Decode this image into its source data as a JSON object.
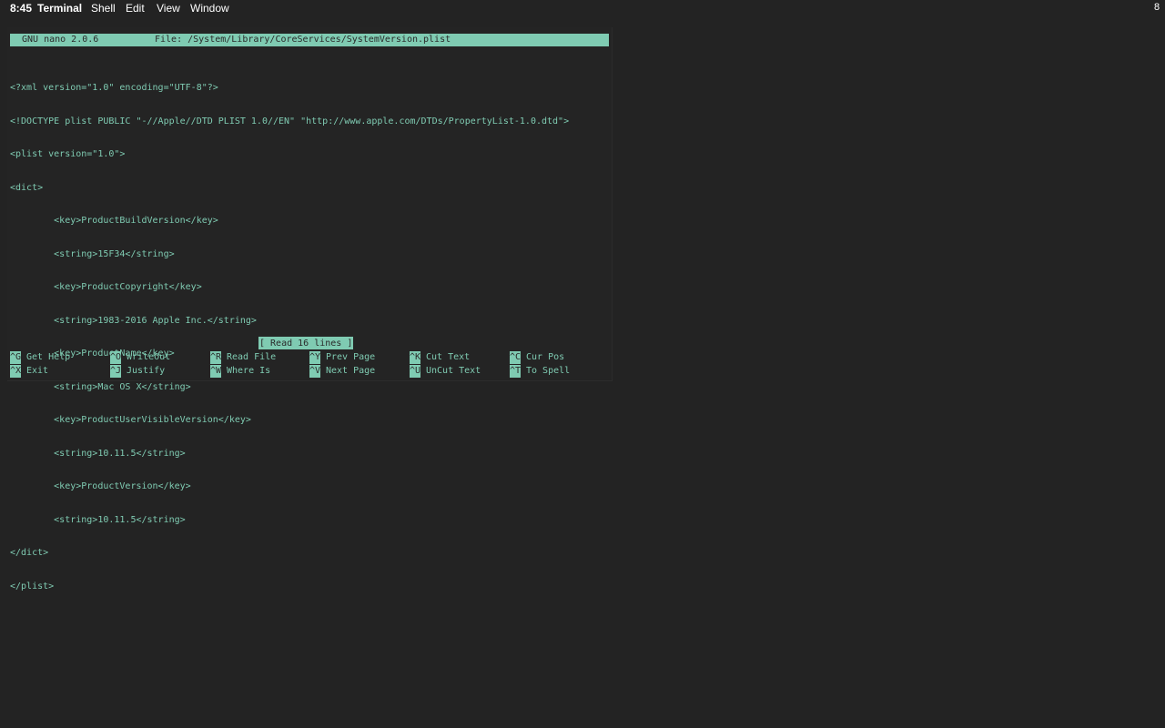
{
  "menubar": {
    "time": "8:45",
    "app_name": "Terminal",
    "items": [
      "Shell",
      "Edit",
      "View",
      "Window"
    ],
    "right_status": "8"
  },
  "nano": {
    "version_label": "GNU nano 2.0.6",
    "file_label": "File: /System/Library/CoreServices/SystemVersion.plist",
    "lines": [
      "<?xml version=\"1.0\" encoding=\"UTF-8\"?>",
      "<!DOCTYPE plist PUBLIC \"-//Apple//DTD PLIST 1.0//EN\" \"http://www.apple.com/DTDs/PropertyList-1.0.dtd\">",
      "<plist version=\"1.0\">",
      "<dict>",
      "        <key>ProductBuildVersion</key>",
      "        <string>15F34</string>",
      "        <key>ProductCopyright</key>",
      "        <string>1983-2016 Apple Inc.</string>",
      "        <key>ProductName</key>",
      "        <string>Mac OS X</string>",
      "        <key>ProductUserVisibleVersion</key>",
      "        <string>10.11.5</string>",
      "        <key>ProductVersion</key>",
      "        <string>10.11.5</string>",
      "</dict>",
      "</plist>"
    ],
    "status_message": "[ Read 16 lines ]",
    "shortcuts": {
      "get_help": {
        "key": "^G",
        "label": "Get Help"
      },
      "writeout": {
        "key": "^O",
        "label": "WriteOut"
      },
      "read_file": {
        "key": "^R",
        "label": "Read File"
      },
      "prev_page": {
        "key": "^Y",
        "label": "Prev Page"
      },
      "cut_text": {
        "key": "^K",
        "label": "Cut Text"
      },
      "cur_pos": {
        "key": "^C",
        "label": "Cur Pos"
      },
      "exit": {
        "key": "^X",
        "label": "Exit"
      },
      "justify": {
        "key": "^J",
        "label": "Justify"
      },
      "where_is": {
        "key": "^W",
        "label": "Where Is"
      },
      "next_page": {
        "key": "^V",
        "label": "Next Page"
      },
      "uncut_text": {
        "key": "^U",
        "label": "UnCut Text"
      },
      "to_spell": {
        "key": "^T",
        "label": "To Spell"
      }
    }
  },
  "colors": {
    "background": "#232323",
    "terminal_text": "#7fcbb2",
    "highlight_bg": "#7fcbb2",
    "highlight_text": "#2a2a2a",
    "menubar_text": "#ffffff"
  }
}
